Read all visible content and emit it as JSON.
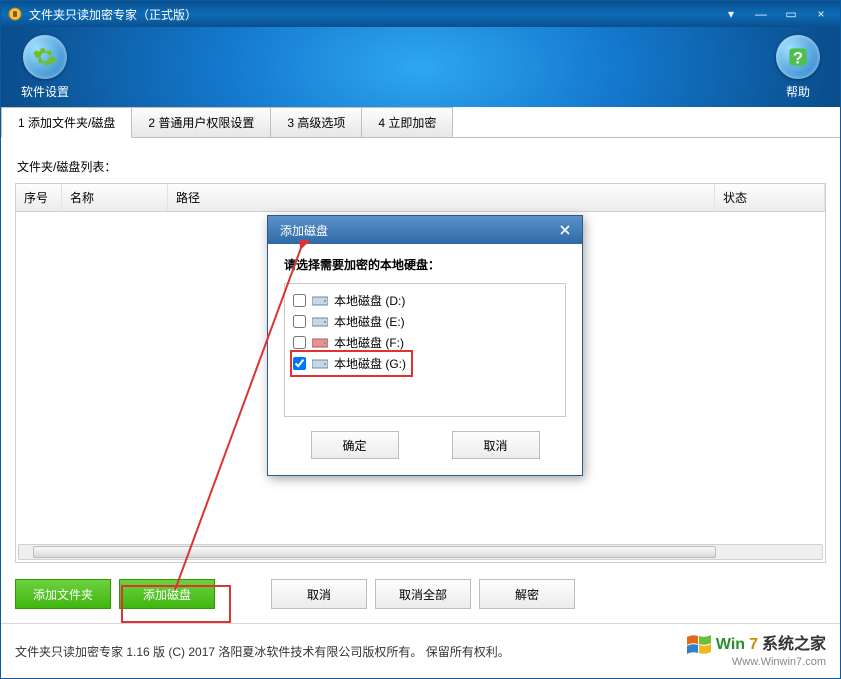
{
  "window": {
    "title": "文件夹只读加密专家（正式版）",
    "min_label": "—",
    "max_label": "▭",
    "close_label": "×"
  },
  "header": {
    "settings_label": "软件设置",
    "help_label": "帮助"
  },
  "tabs": {
    "t1": "1 添加文件夹/磁盘",
    "t2": "2 普通用户权限设置",
    "t3": "3 高级选项",
    "t4": "4 立即加密"
  },
  "panel": {
    "list_title": "文件夹/磁盘列表：",
    "col_no": "序号",
    "col_name": "名称",
    "col_path": "路径",
    "col_status": "状态"
  },
  "buttons": {
    "add_folder": "添加文件夹",
    "add_disk": "添加磁盘",
    "cancel": "取消",
    "cancel_all": "取消全部",
    "decrypt": "解密"
  },
  "footer": {
    "copyright": "文件夹只读加密专家 1.16 版 (C) 2017 洛阳夏冰软件技术有限公司版权所有。 保留所有权利。",
    "logo_win": "Win",
    "logo_seven": "7",
    "logo_cn": "系统之家",
    "logo_url": "Www.Winwin7.com"
  },
  "modal": {
    "title": "添加磁盘",
    "instruction": "请选择需要加密的本地硬盘：",
    "drives": {
      "d": "本地磁盘 (D:)",
      "e": "本地磁盘 (E:)",
      "f": "本地磁盘 (F:)",
      "g": "本地磁盘 (G:)"
    },
    "ok": "确定",
    "cancel": "取消"
  }
}
